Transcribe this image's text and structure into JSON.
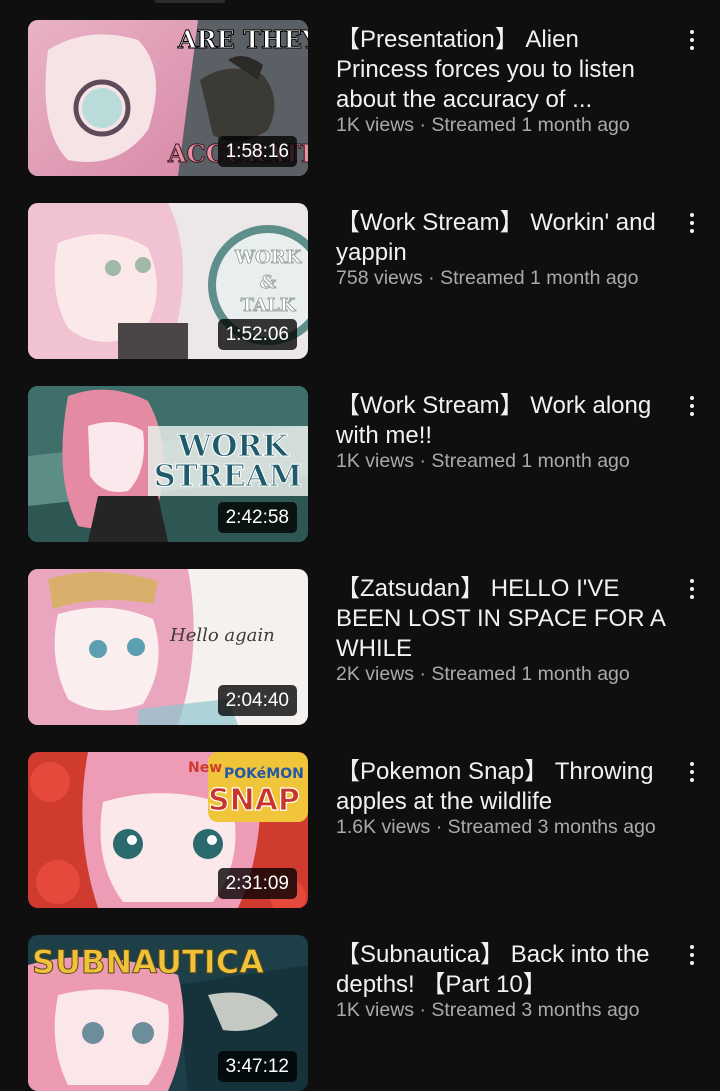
{
  "videos": [
    {
      "title": "【Presentation】 Alien Princess forces you to listen about the accuracy of ...",
      "views": "1K views",
      "age": "Streamed 1 month ago",
      "duration": "1:58:16",
      "thumb_text": [
        "ARE THEY",
        "ACCURATE"
      ],
      "thumb_accent": "#f2a7c3"
    },
    {
      "title": "【Work Stream】 Workin' and yappin",
      "views": "758 views",
      "age": "Streamed 1 month ago",
      "duration": "1:52:06",
      "thumb_text": [
        "WORK",
        "&",
        "TALK"
      ],
      "thumb_accent": "#f4c7d6"
    },
    {
      "title": "【Work Stream】 Work along with me!!",
      "views": "1K views",
      "age": "Streamed 1 month ago",
      "duration": "2:42:58",
      "thumb_text": [
        "WORK",
        "STREAM"
      ],
      "thumb_accent": "#2f6e6a"
    },
    {
      "title": "【Zatsudan】 HELLO I'VE BEEN LOST IN SPACE FOR A WHILE",
      "views": "2K views",
      "age": "Streamed 1 month ago",
      "duration": "2:04:40",
      "thumb_text": [
        "Hello again"
      ],
      "thumb_accent": "#f7f2f0"
    },
    {
      "title": "【Pokemon Snap】 Throwing apples at the wildlife",
      "views": "1.6K views",
      "age": "Streamed 3 months ago",
      "duration": "2:31:09",
      "thumb_text": [
        "New",
        "POKéMON",
        "SNAP"
      ],
      "thumb_accent": "#c9352b"
    },
    {
      "title": "【Subnautica】 Back into the depths! 【Part 10】",
      "views": "1K views",
      "age": "Streamed 3 months ago",
      "duration": "3:47:12",
      "thumb_text": [
        "SUBNAUTICA"
      ],
      "thumb_accent": "#1d4a52"
    }
  ],
  "separator": " · "
}
